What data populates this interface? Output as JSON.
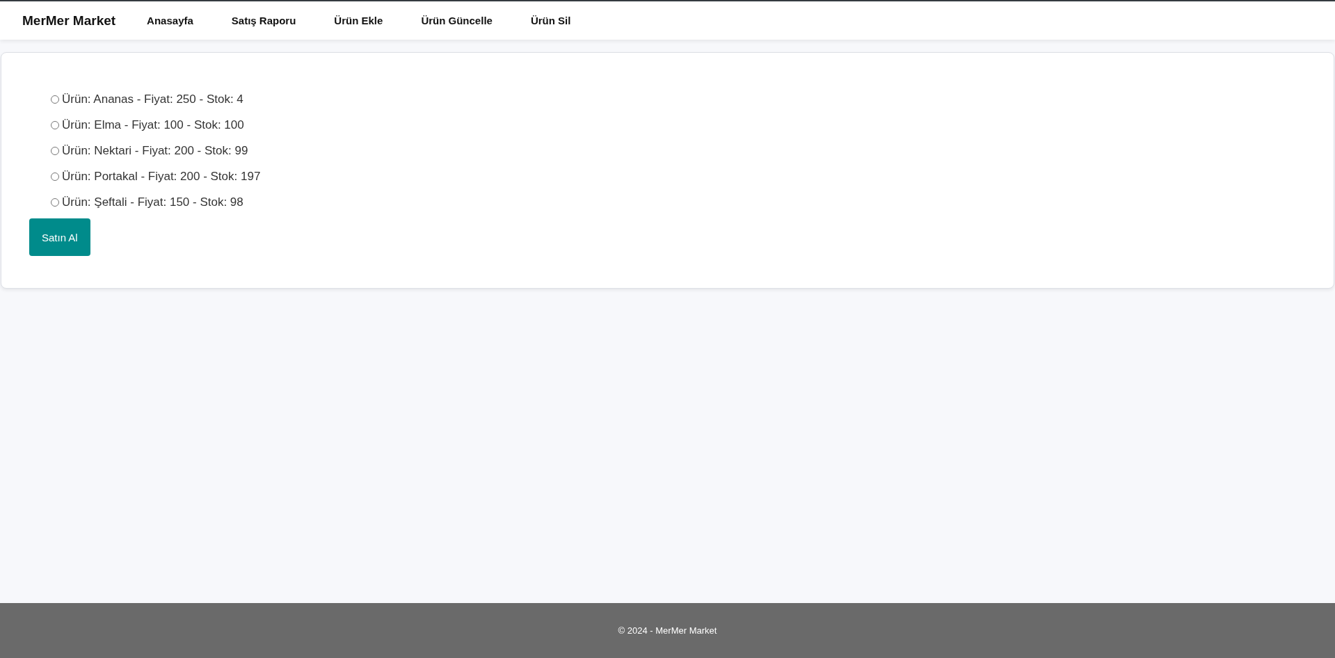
{
  "navbar": {
    "brand": "MerMer Market",
    "links": [
      {
        "label": "Anasayfa"
      },
      {
        "label": "Satış Raporu"
      },
      {
        "label": "Ürün Ekle"
      },
      {
        "label": "Ürün Güncelle"
      },
      {
        "label": "Ürün Sil"
      }
    ]
  },
  "products": [
    {
      "label": "Ürün: Ananas - Fiyat: 250 - Stok: 4",
      "selected": false
    },
    {
      "label": "Ürün: Elma - Fiyat: 100 - Stok: 100",
      "selected": false
    },
    {
      "label": "Ürün: Nektari - Fiyat: 200 - Stok: 99",
      "selected": false
    },
    {
      "label": "Ürün: Portakal - Fiyat: 200 - Stok: 197",
      "selected": false
    },
    {
      "label": "Ürün: Şeftali - Fiyat: 150 - Stok: 98",
      "selected": false
    }
  ],
  "buy_button": "Satın Al",
  "footer": "© 2024 - MerMer Market"
}
